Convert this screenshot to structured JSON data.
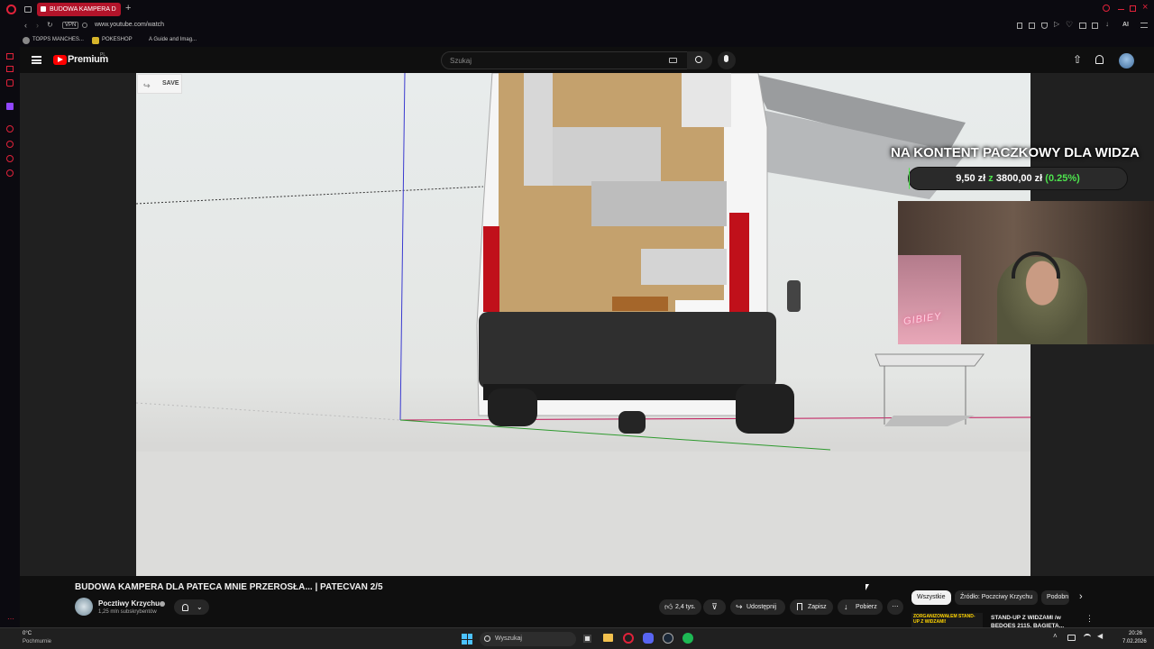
{
  "browser": {
    "tab_title": "BUDOWA KAMPERA D",
    "url": "www.youtube.com/watch",
    "vpn_label": "VPN",
    "bookmarks": [
      "TOPPS MANCHES...",
      "POKESHOP",
      "A Guide and Imag..."
    ],
    "ai_label": "AI",
    "accent": "#b3142a"
  },
  "youtube": {
    "logo_text": "Premium",
    "region": "PL",
    "search_placeholder": "Szukaj"
  },
  "video": {
    "save_label": "SAVE",
    "donation_title": "NA KONTENT PACZKOWY DLA WIDZA",
    "donation_current": "9,50 zł",
    "donation_sep": "z",
    "donation_goal": "3800,00 zł",
    "donation_percent": "(0.25%)",
    "donation_progress": 0.0025,
    "webcam_sign": "GIBIEY",
    "title": "BUDOWA KAMPERA DLA PATECA MNIE PRZEROSŁA... | PATECVAN 2/5"
  },
  "channel": {
    "name": "Pocztiwy Krzychu",
    "subscribers": "1,25 mln subskrybentów"
  },
  "actions": {
    "likes": "2,4 tys.",
    "share": "Udostępnij",
    "save": "Zapisz",
    "download": "Pobierz"
  },
  "chips": [
    "Wszystkie",
    "Źródło: Poczciwy Krzychu",
    "Podobn"
  ],
  "recommended": {
    "thumb_text": "ZORGANIZOWAŁEM STAND-UP Z WIDZAMI!",
    "title_line1": "STAND-UP Z WIDZAMI /w",
    "title_line2": "BEDOES 2115, BAGIETA..."
  },
  "taskbar": {
    "temp": "0°C",
    "weather": "Pochmurnie",
    "search": "Wyszukaj",
    "time": "20:26",
    "date": "7.02.2026"
  }
}
